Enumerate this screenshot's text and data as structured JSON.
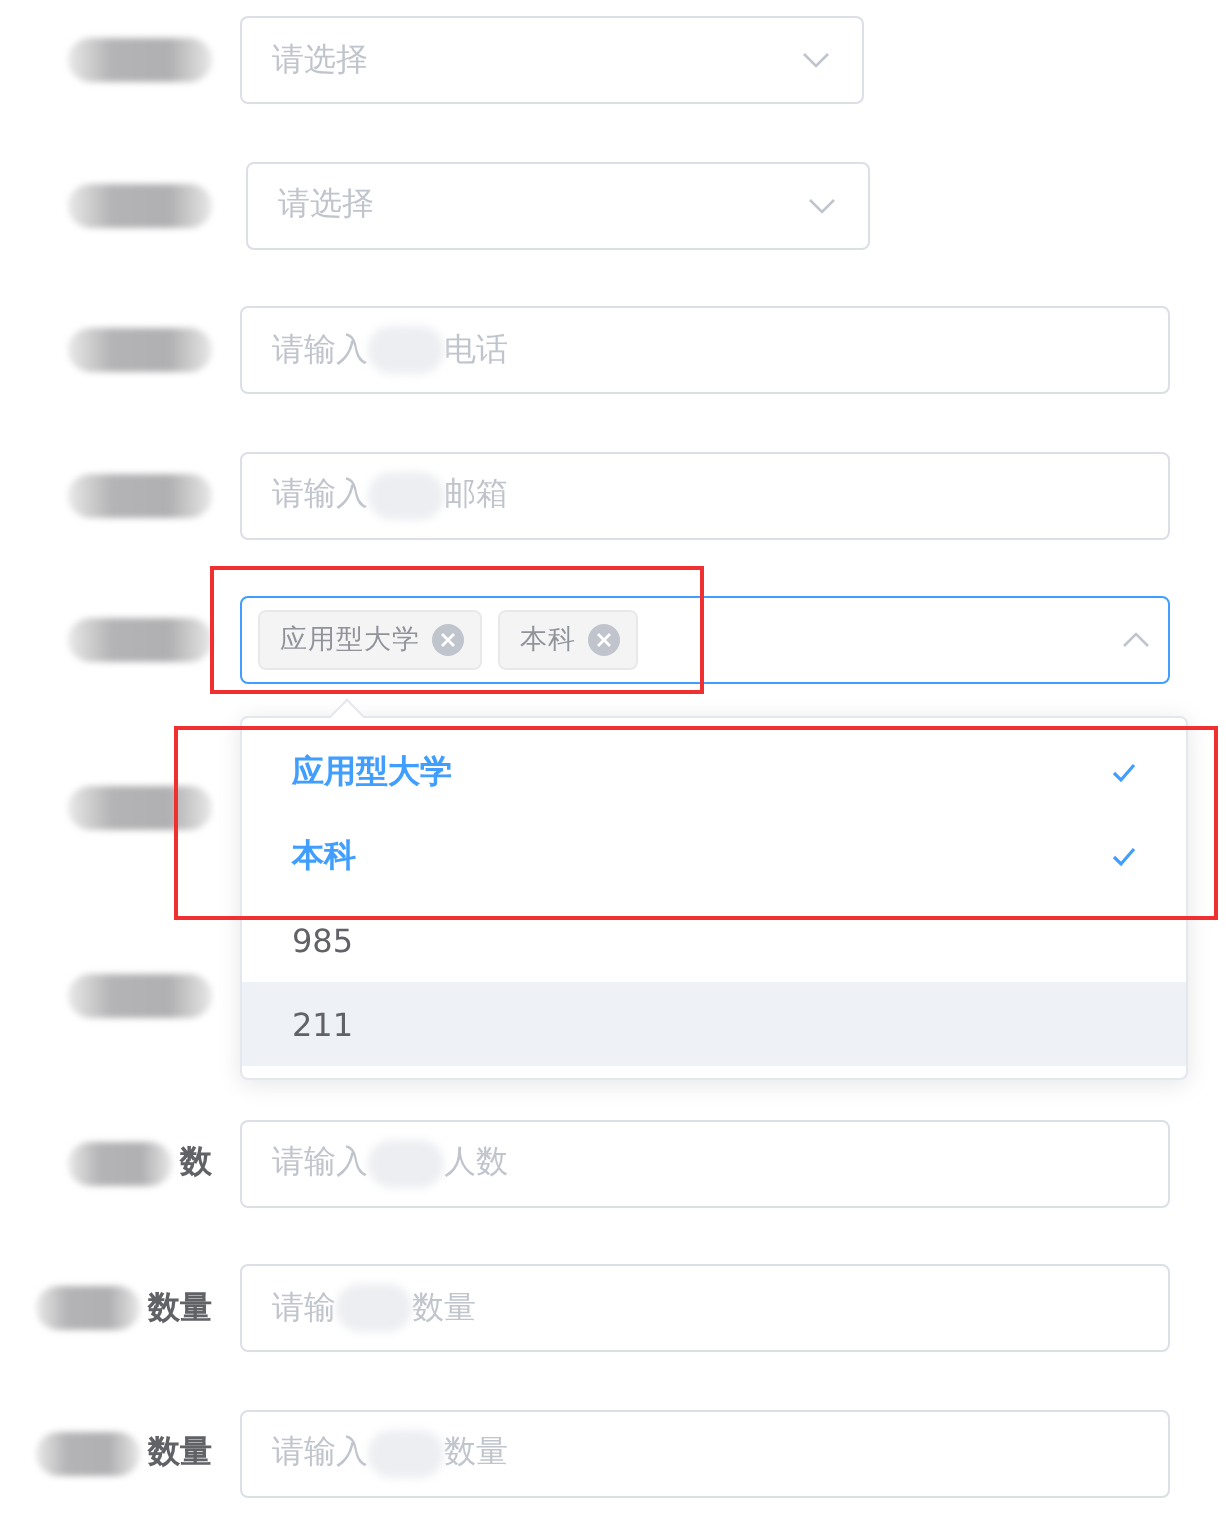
{
  "form": {
    "rows": [
      {
        "kind": "select",
        "placeholder": "请选择"
      },
      {
        "kind": "select",
        "placeholder": "请选择"
      },
      {
        "kind": "input",
        "placeholder_start": "请输入",
        "placeholder_end": "电话"
      },
      {
        "kind": "input",
        "placeholder_start": "请输入",
        "placeholder_end": "邮箱"
      },
      {
        "kind": "tag-select",
        "expanded": true,
        "tags": [
          "应用型大学",
          "本科"
        ]
      },
      {
        "kind": "covered"
      },
      {
        "kind": "covered"
      },
      {
        "kind": "input",
        "label_end": "数",
        "placeholder_start": "请输入",
        "placeholder_end": "人数"
      },
      {
        "kind": "input",
        "label_end": "数量",
        "placeholder_start": "请输",
        "placeholder_end": "数量"
      },
      {
        "kind": "input",
        "label_end": "数量",
        "placeholder_start": "请输入",
        "placeholder_end": "数量"
      }
    ]
  },
  "dropdown": {
    "options": [
      {
        "label": "应用型大学",
        "selected": true,
        "hovered": false
      },
      {
        "label": "本科",
        "selected": true,
        "hovered": false
      },
      {
        "label": "985",
        "selected": false,
        "hovered": false
      },
      {
        "label": "211",
        "selected": false,
        "hovered": true
      }
    ]
  },
  "annotations": [
    {
      "kind": "highlight-box"
    },
    {
      "kind": "highlight-box"
    }
  ]
}
